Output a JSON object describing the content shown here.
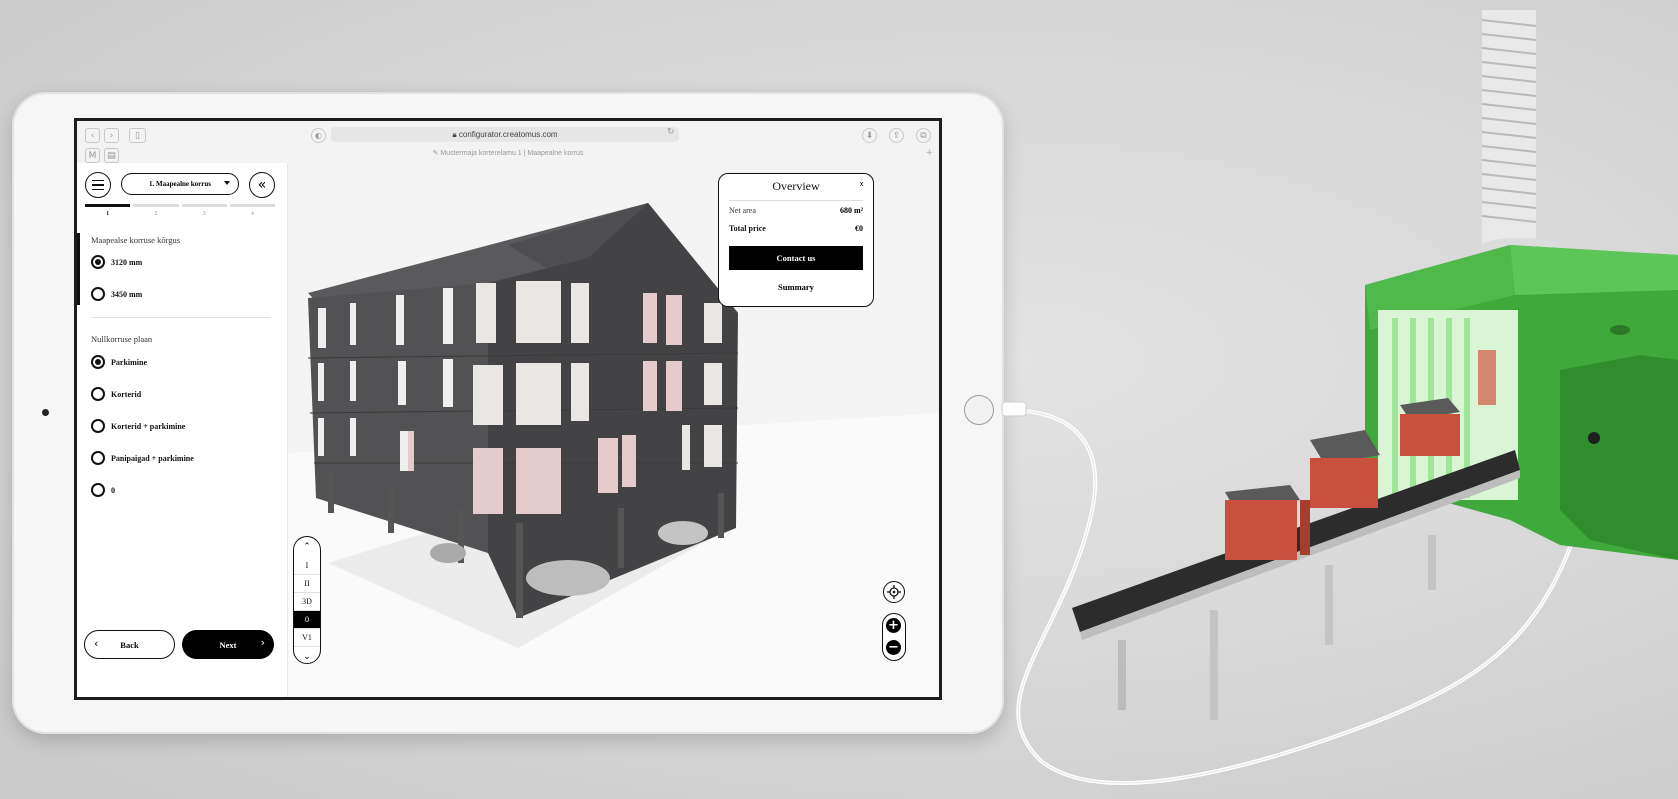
{
  "browser": {
    "url": "configurator.creatomus.com",
    "tab_title": "Mustermaja korterelamu 1 | Maapealne korrus"
  },
  "panel": {
    "floor_select": "1. Maapealne korrus",
    "steps": [
      "1",
      "2",
      "3",
      "4"
    ],
    "group1": {
      "label": "Maapealse korruse kõrgus",
      "options": [
        "3120 mm",
        "3450 mm"
      ],
      "selected": "3120 mm"
    },
    "group2": {
      "label": "Nullkorruse plaan",
      "options": [
        "Parkimine",
        "Korterid",
        "Korterid + parkimine",
        "Panipaigad + parkimine",
        "0"
      ],
      "selected": "Parkimine"
    },
    "back_label": "Back",
    "next_label": "Next"
  },
  "overview": {
    "title": "Overview",
    "net_area_label": "Net area",
    "net_area_value": "680 m²",
    "total_price_label": "Total price",
    "total_price_value": "€0",
    "contact_label": "Contact us",
    "summary_label": "Summary"
  },
  "floor_switcher": [
    "I",
    "II",
    "3D",
    "0",
    "V1"
  ],
  "floor_switcher_active": "0",
  "colors": {
    "accent": "#000000",
    "machine_green": "#3fa93c",
    "house_red": "#c9503c",
    "building_grey": "#4a4a4c"
  }
}
